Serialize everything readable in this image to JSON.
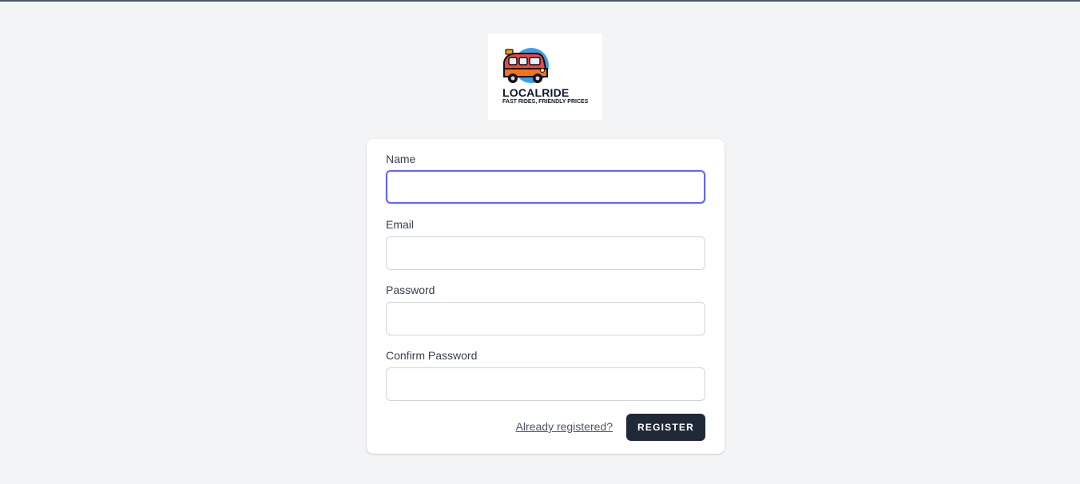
{
  "brand": {
    "logo_icon": "camper-van-icon",
    "name": "LOCALRIDE",
    "tagline": "FAST RIDES, FRIENDLY PRICES"
  },
  "form": {
    "fields": [
      {
        "label": "Name",
        "value": "",
        "type": "text",
        "focused": true
      },
      {
        "label": "Email",
        "value": "",
        "type": "email",
        "focused": false
      },
      {
        "label": "Password",
        "value": "",
        "type": "password",
        "focused": false
      },
      {
        "label": "Confirm Password",
        "value": "",
        "type": "password",
        "focused": false
      }
    ],
    "login_link": "Already registered?",
    "submit_label": "REGISTER"
  },
  "colors": {
    "background": "#f3f4f6",
    "card": "#ffffff",
    "focus_ring": "#6366f1",
    "button": "#1f2937"
  }
}
